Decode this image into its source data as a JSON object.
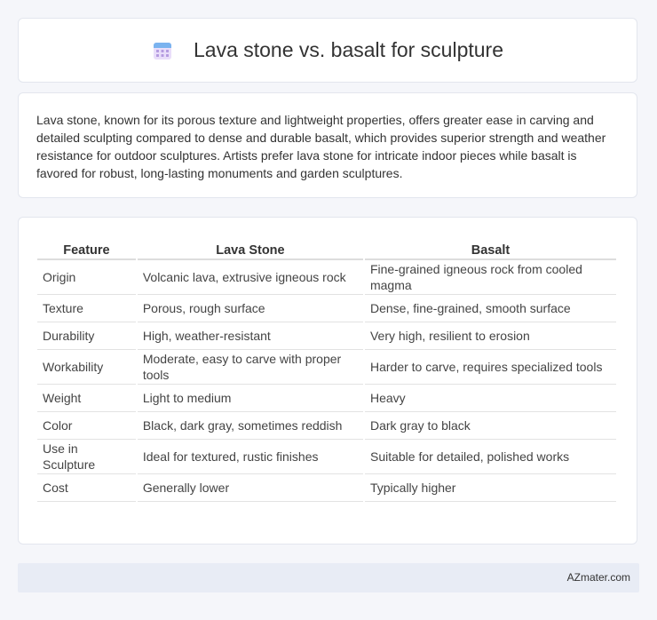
{
  "header": {
    "title": "Lava stone vs. basalt for sculpture",
    "icon": "calendar-icon"
  },
  "intro": {
    "text": "Lava stone, known for its porous texture and lightweight properties, offers greater ease in carving and detailed sculpting compared to dense and durable basalt, which provides superior strength and weather resistance for outdoor sculptures. Artists prefer lava stone for intricate indoor pieces while basalt is favored for robust, long-lasting monuments and garden sculptures."
  },
  "table": {
    "headers": [
      "Feature",
      "Lava Stone",
      "Basalt"
    ],
    "rows": [
      [
        "Origin",
        "Volcanic lava, extrusive igneous rock",
        "Fine-grained igneous rock from cooled magma"
      ],
      [
        "Texture",
        "Porous, rough surface",
        "Dense, fine-grained, smooth surface"
      ],
      [
        "Durability",
        "High, weather-resistant",
        "Very high, resilient to erosion"
      ],
      [
        "Workability",
        "Moderate, easy to carve with proper tools",
        "Harder to carve, requires specialized tools"
      ],
      [
        "Weight",
        "Light to medium",
        "Heavy"
      ],
      [
        "Color",
        "Black, dark gray, sometimes reddish",
        "Dark gray to black"
      ],
      [
        "Use in Sculpture",
        "Ideal for textured, rustic finishes",
        "Suitable for detailed, polished works"
      ],
      [
        "Cost",
        "Generally lower",
        "Typically higher"
      ]
    ]
  },
  "footer": {
    "brand": "AZmater.com"
  }
}
